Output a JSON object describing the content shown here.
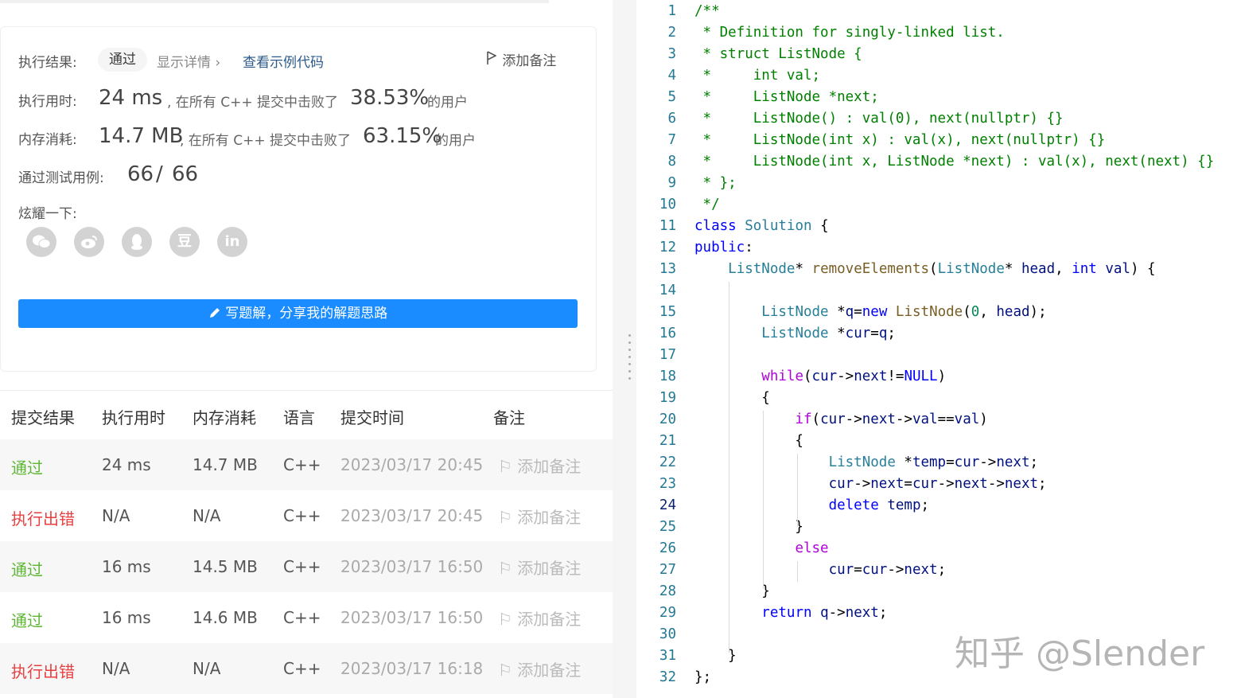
{
  "result": {
    "label": "执行结果:",
    "status": "通过",
    "show_details": "显示详情 ›",
    "view_example": "查看示例代码",
    "add_note": "添加备注"
  },
  "runtime": {
    "label": "执行用时:",
    "value": "24 ms",
    "mid": ", 在所有 C++ 提交中击败了",
    "percent": "38.53%",
    "suffix": "的用户"
  },
  "memory": {
    "label": "内存消耗:",
    "value": "14.7 MB",
    "mid": ", 在所有 C++ 提交中击败了",
    "percent": "63.15%",
    "suffix": "的用户"
  },
  "tests": {
    "label": "通过测试用例:",
    "passed": "66",
    "sep": "/",
    "total": "66"
  },
  "share": {
    "label": "炫耀一下:",
    "icons": [
      "wechat-icon",
      "weibo-icon",
      "qq-icon",
      "douban-icon",
      "linkedin-icon"
    ],
    "douban_text": "豆",
    "linkedin_text": "in"
  },
  "write_button": "写题解，分享我的解题思路",
  "table": {
    "headers": [
      "提交结果",
      "执行用时",
      "内存消耗",
      "语言",
      "提交时间",
      "备注"
    ],
    "rows": [
      {
        "status": "通过",
        "kind": "ok",
        "time": "24 ms",
        "memory": "14.7 MB",
        "lang": "C++",
        "date": "2023/03/17 20:45",
        "note": "添加备注"
      },
      {
        "status": "执行出错",
        "kind": "err",
        "time": "N/A",
        "memory": "N/A",
        "lang": "C++",
        "date": "2023/03/17 20:45",
        "note": "添加备注"
      },
      {
        "status": "通过",
        "kind": "ok",
        "time": "16 ms",
        "memory": "14.5 MB",
        "lang": "C++",
        "date": "2023/03/17 16:50",
        "note": "添加备注"
      },
      {
        "status": "通过",
        "kind": "ok",
        "time": "16 ms",
        "memory": "14.6 MB",
        "lang": "C++",
        "date": "2023/03/17 16:50",
        "note": "添加备注"
      },
      {
        "status": "执行出错",
        "kind": "err",
        "time": "N/A",
        "memory": "N/A",
        "lang": "C++",
        "date": "2023/03/17 16:18",
        "note": "添加备注"
      }
    ]
  },
  "code_lines": [
    "/**",
    " * Definition for singly-linked list.",
    " * struct ListNode {",
    " *     int val;",
    " *     ListNode *next;",
    " *     ListNode() : val(0), next(nullptr) {}",
    " *     ListNode(int x) : val(x), next(nullptr) {}",
    " *     ListNode(int x, ListNode *next) : val(x), next(next) {}",
    " * };",
    " */",
    "class Solution {",
    "public:",
    "    ListNode* removeElements(ListNode* head, int val) {",
    "",
    "        ListNode *q=new ListNode(0, head);",
    "        ListNode *cur=q;",
    "",
    "        while(cur->next!=NULL)",
    "        {",
    "            if(cur->next->val==val)",
    "            {",
    "                ListNode *temp=cur->next;",
    "                cur->next=cur->next->next;",
    "                delete temp;",
    "            }",
    "            else",
    "                cur=cur->next;",
    "        }",
    "        return q->next;",
    "",
    "    }",
    "};"
  ],
  "current_line": 24,
  "watermark": "知乎 @Slender",
  "colors": {
    "accent": "#1a8cff",
    "pass": "#5cb634",
    "error": "#e84040"
  }
}
